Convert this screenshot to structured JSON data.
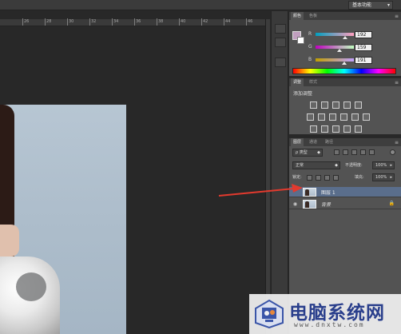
{
  "workspace": {
    "label": "基本功能"
  },
  "ruler": {
    "ticks": [
      "26",
      "28",
      "30",
      "32",
      "34",
      "36",
      "38",
      "40",
      "42",
      "44",
      "46"
    ]
  },
  "color_panel": {
    "tabs": [
      "颜色",
      "色板"
    ],
    "channels": [
      {
        "label": "R",
        "value": "192"
      },
      {
        "label": "G",
        "value": "159"
      },
      {
        "label": "B",
        "value": "191"
      }
    ],
    "foreground_color": "#c09fbf",
    "background_color": "#ffffff"
  },
  "adjustments_panel": {
    "tabs": [
      "调整",
      "样式"
    ],
    "title": "添加调整",
    "icons": [
      "brightness-icon",
      "levels-icon",
      "curves-icon",
      "exposure-icon",
      "vibrance-icon",
      "hue-saturation-icon",
      "color-balance-icon",
      "black-white-icon",
      "photo-filter-icon",
      "channel-mixer-icon",
      "color-lookup-icon",
      "invert-icon",
      "posterize-icon",
      "threshold-icon",
      "gradient-map-icon",
      "selective-color-icon"
    ]
  },
  "layers_panel": {
    "tabs": [
      "图层",
      "通道",
      "路径"
    ],
    "filter_type": "ρ 类型",
    "blend_mode": "正常",
    "opacity_label": "不透明度:",
    "opacity_value": "100%",
    "lock_label": "锁定:",
    "fill_label": "填充:",
    "fill_value": "100%",
    "layers": [
      {
        "name": "图层 1",
        "selected": true,
        "visible": false,
        "locked": false
      },
      {
        "name": "背景",
        "selected": false,
        "visible": true,
        "locked": true
      }
    ]
  },
  "watermark": {
    "title": "电脑系统网",
    "url": "www.dnxtw.com"
  }
}
